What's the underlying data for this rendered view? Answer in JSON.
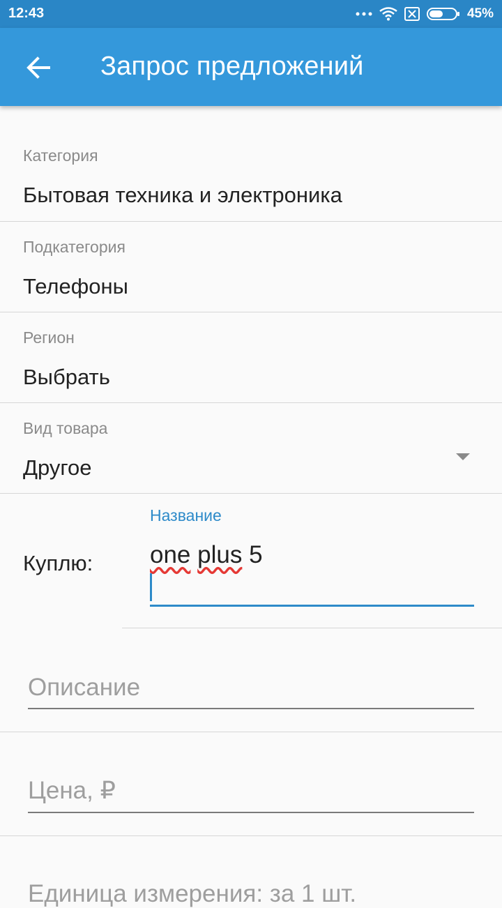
{
  "status_bar": {
    "time": "12:43",
    "battery": "45%"
  },
  "app_bar": {
    "title": "Запрос предложений"
  },
  "form": {
    "category": {
      "label": "Категория",
      "value": "Бытовая техника и электроника"
    },
    "subcategory": {
      "label": "Подкатегория",
      "value": "Телефоны"
    },
    "region": {
      "label": "Регион",
      "value": "Выбрать"
    },
    "product_type": {
      "label": "Вид товара",
      "value": "Другое"
    },
    "buy": {
      "label": "Куплю:",
      "name_label": "Название",
      "name_words": [
        "one",
        "plus",
        "5"
      ]
    },
    "description": {
      "placeholder": "Описание"
    },
    "price": {
      "placeholder": "Цена, ₽"
    },
    "unit": {
      "placeholder": "Единица измерения: за 1 шт."
    }
  },
  "colors": {
    "app_bar": "#3498db",
    "status_bar": "#2a86c6",
    "accent": "#2d8ac9"
  },
  "icons": [
    "back-arrow-icon",
    "more-dots-icon",
    "wifi-icon",
    "sim-off-icon",
    "battery-icon"
  ]
}
